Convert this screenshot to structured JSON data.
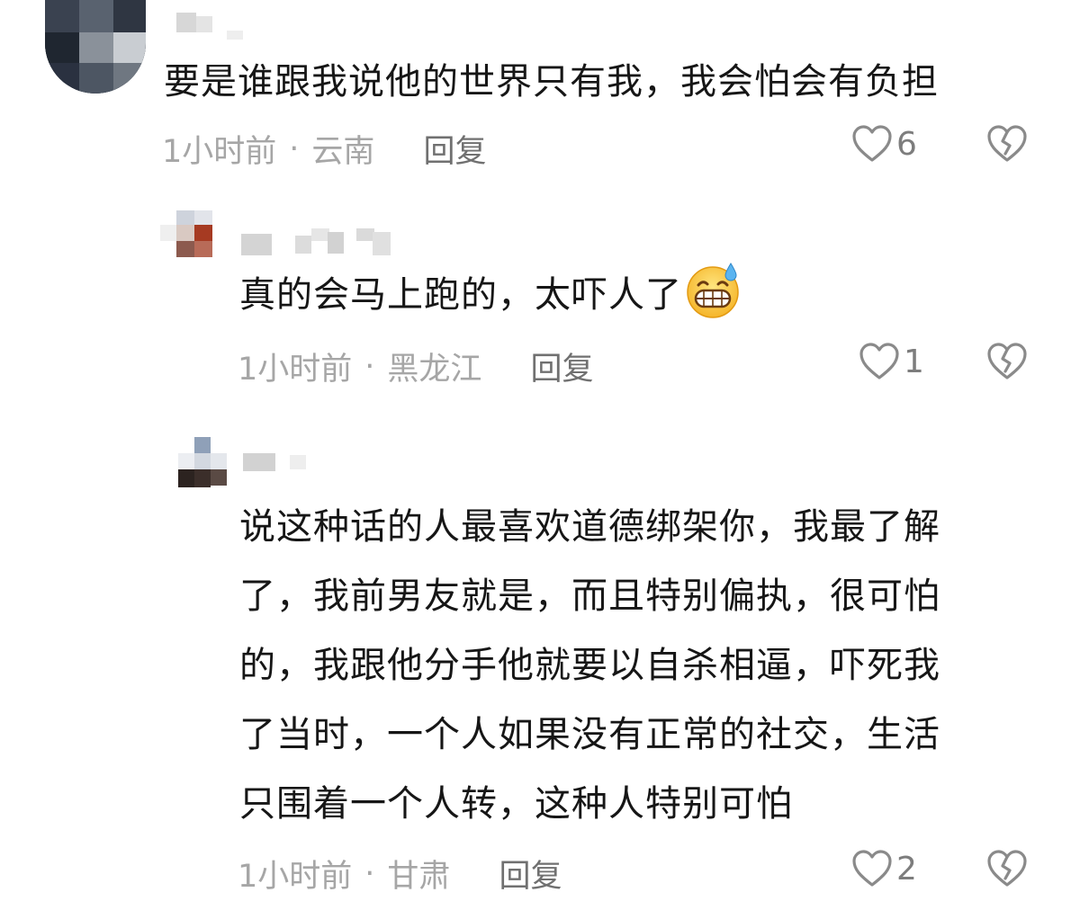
{
  "comments": [
    {
      "text": "要是谁跟我说他的世界只有我，我会怕会有负担",
      "time": "1小时前",
      "region": "云南",
      "reply_label": "回复",
      "likes": "6"
    },
    {
      "text": "真的会马上跑的，太吓人了",
      "emoji": "grinning-sweat-emoji",
      "time": "1小时前",
      "region": "黑龙江",
      "reply_label": "回复",
      "likes": "1"
    },
    {
      "lines": [
        "说这种话的人最喜欢道德绑架你，我最了解",
        "了，我前男友就是，而且特别偏执，很可怕",
        "的，我跟他分手他就要以自杀相逼，吓死我",
        "了当时，一个人如果没有正常的社交，生活",
        "只围着一个人转，这种人特别可怕"
      ],
      "time": "1小时前",
      "region": "甘肃",
      "reply_label": "回复",
      "likes": "2"
    }
  ],
  "separator": "·",
  "icons": {
    "like": "heart-outline-icon",
    "dislike": "broken-heart-icon"
  },
  "colors": {
    "text": "#161616",
    "meta": "#a6a6a6",
    "reply": "#707070",
    "icon": "#8a8a8a"
  }
}
